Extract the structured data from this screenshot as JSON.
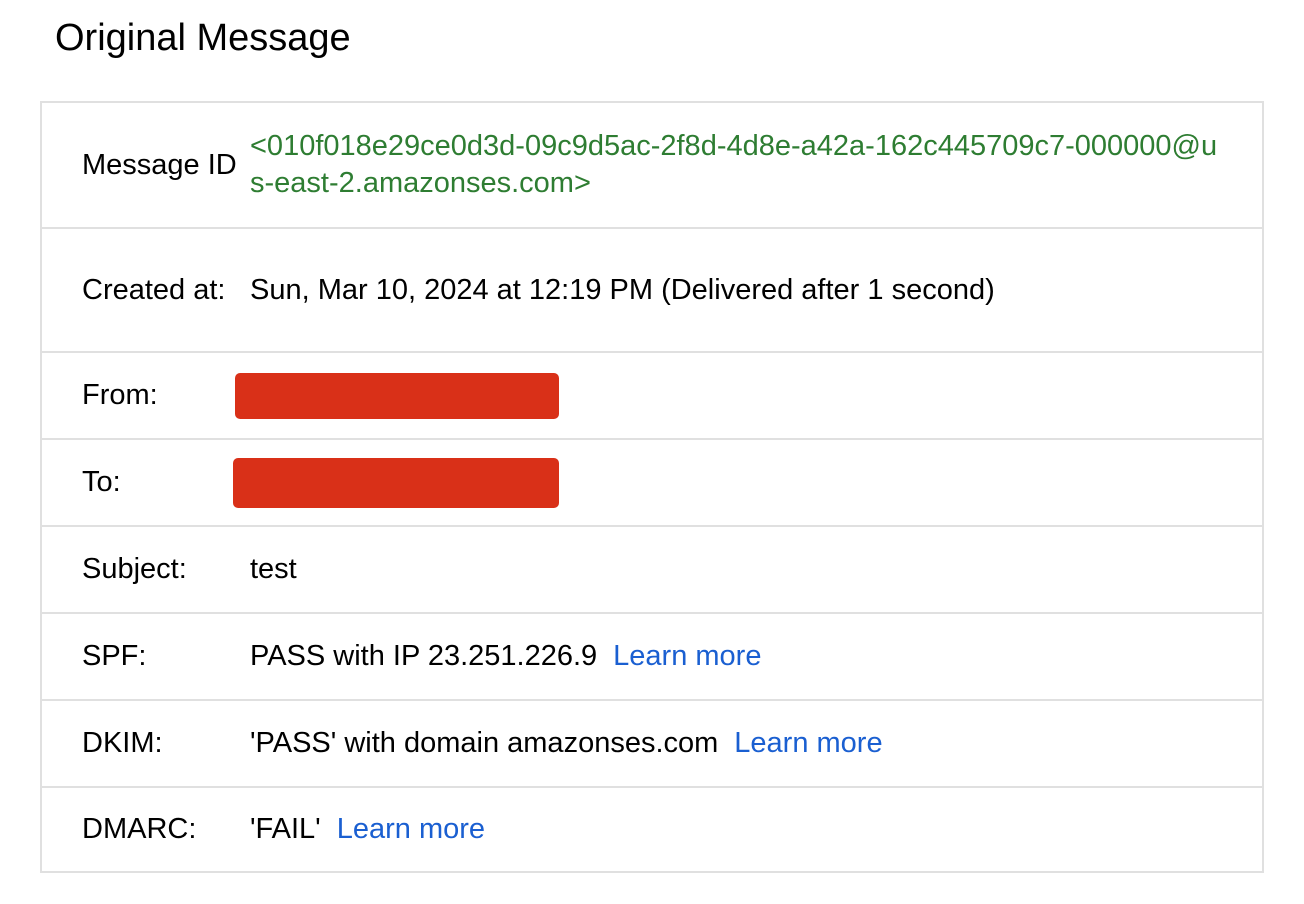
{
  "title": "Original Message",
  "rows": {
    "message_id": {
      "label": "Message ID",
      "value": "<010f018e29ce0d3d-09c9d5ac-2f8d-4d8e-a42a-162c445709c7-000000@us-east-2.amazonses.com>"
    },
    "created_at": {
      "label": "Created at:",
      "value": "Sun, Mar 10, 2024 at 12:19 PM (Delivered after 1 second)"
    },
    "from": {
      "label": "From:"
    },
    "to": {
      "label": "To:"
    },
    "subject": {
      "label": "Subject:",
      "value": "test"
    },
    "spf": {
      "label": "SPF:",
      "value": "PASS with IP 23.251.226.9",
      "link": "Learn more"
    },
    "dkim": {
      "label": "DKIM:",
      "value": "'PASS' with domain amazonses.com",
      "link": "Learn more"
    },
    "dmarc": {
      "label": "DMARC:",
      "value": "'FAIL'",
      "link": "Learn more"
    }
  },
  "colors": {
    "message_id_text": "#2e7d32",
    "link": "#1a5fd1",
    "redaction": "#d93018",
    "border": "#e0e0e0"
  }
}
